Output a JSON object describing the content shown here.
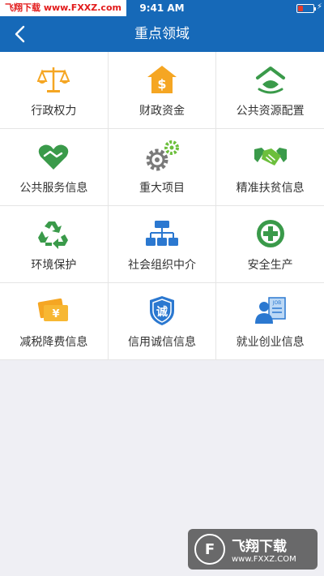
{
  "status": {
    "carrier_prefix": "飞翔下载",
    "carrier_url": "www.FXXZ.com",
    "time": "9:41 AM"
  },
  "header": {
    "title": "重点领域"
  },
  "grid": [
    [
      {
        "label": "行政权力",
        "icon": "scale-icon"
      },
      {
        "label": "财政资金",
        "icon": "money-house-icon"
      },
      {
        "label": "公共资源配置",
        "icon": "resource-icon"
      }
    ],
    [
      {
        "label": "公共服务信息",
        "icon": "heart-hands-icon"
      },
      {
        "label": "重大项目",
        "icon": "gears-icon"
      },
      {
        "label": "精准扶贫信息",
        "icon": "handshake-icon"
      }
    ],
    [
      {
        "label": "环境保护",
        "icon": "recycle-icon"
      },
      {
        "label": "社会组织中介",
        "icon": "org-chart-icon"
      },
      {
        "label": "安全生产",
        "icon": "safety-cross-icon"
      }
    ],
    [
      {
        "label": "减税降费信息",
        "icon": "tax-cards-icon"
      },
      {
        "label": "信用诚信信息",
        "icon": "shield-icon"
      },
      {
        "label": "就业创业信息",
        "icon": "job-icon"
      }
    ]
  ],
  "watermark": {
    "name": "飞翔下载",
    "url": "www.FXXZ.COM"
  },
  "colors": {
    "nav": "#1669b8",
    "orange": "#f5a623",
    "green": "#3a9a4a",
    "blue": "#2b78d0"
  }
}
